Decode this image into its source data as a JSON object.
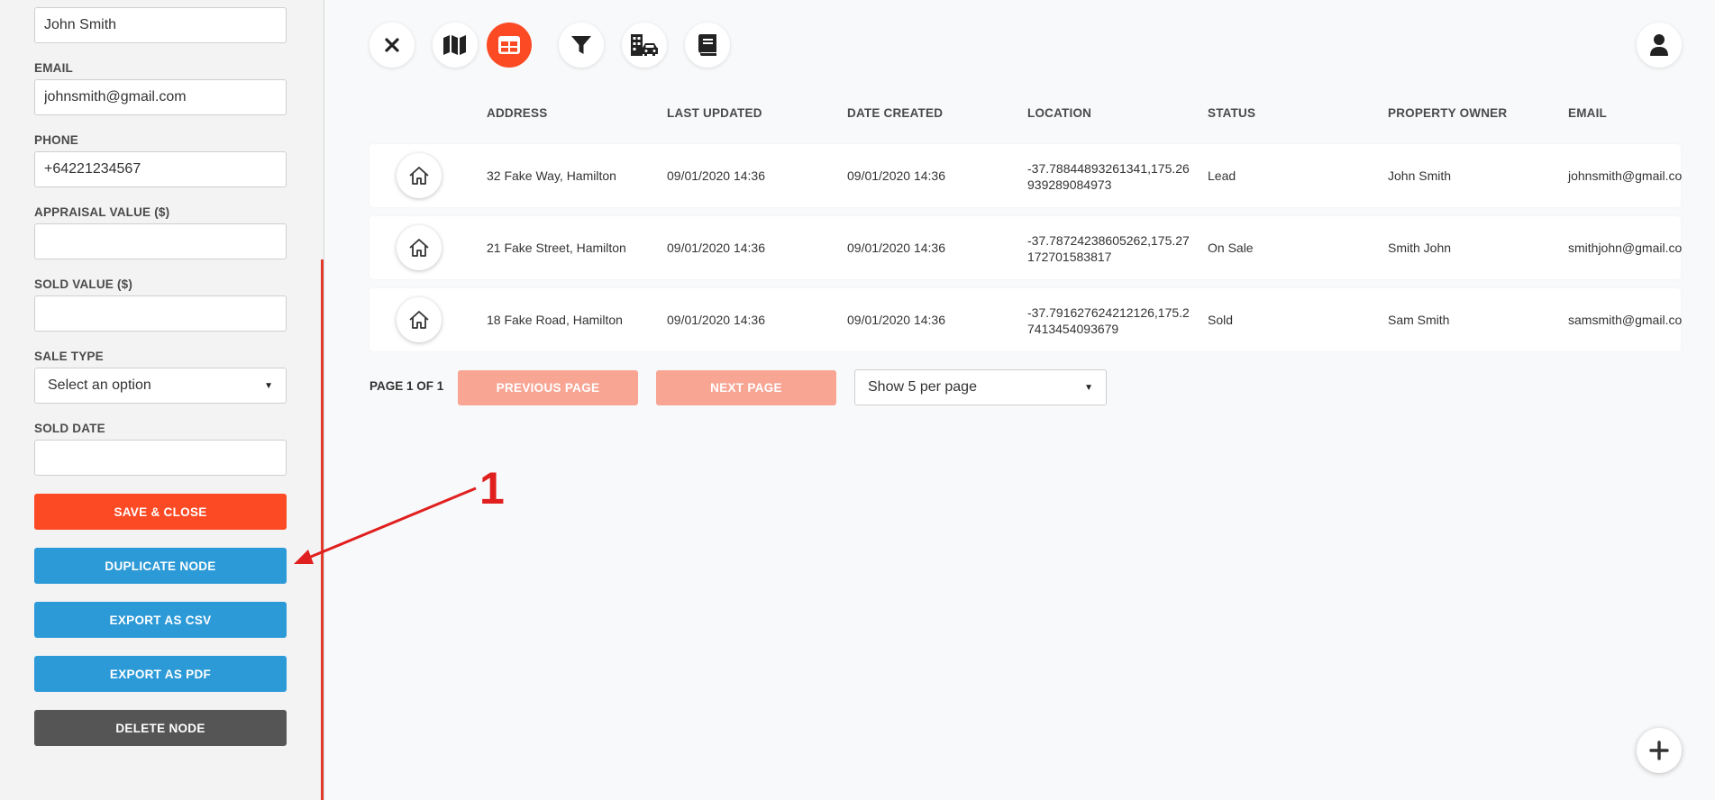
{
  "form": {
    "name_value": "John Smith",
    "email_label": "EMAIL",
    "email_value": "johnsmith@gmail.com",
    "phone_label": "PHONE",
    "phone_value": "+64221234567",
    "appraisal_label": "APPRAISAL VALUE ($)",
    "appraisal_value": "",
    "sold_value_label": "SOLD VALUE ($)",
    "sold_value_value": "",
    "sale_type_label": "SALE TYPE",
    "sale_type_value": "Select an option",
    "sold_date_label": "SOLD DATE",
    "sold_date_value": ""
  },
  "actions": {
    "save_close": "SAVE & CLOSE",
    "duplicate": "DUPLICATE NODE",
    "export_csv": "EXPORT AS CSV",
    "export_pdf": "EXPORT AS PDF",
    "delete": "DELETE NODE"
  },
  "annotation": {
    "number": "1",
    "color": "#e01f1f"
  },
  "toolbar": {
    "items": [
      {
        "icon": "close-icon"
      },
      {
        "icon": "map-icon"
      },
      {
        "icon": "table-icon",
        "active": true
      },
      {
        "icon": "filter-icon"
      },
      {
        "icon": "building-car-icon"
      },
      {
        "icon": "book-icon"
      }
    ],
    "accent_color": "#fc4a24"
  },
  "table": {
    "headers": [
      "ADDRESS",
      "LAST UPDATED",
      "DATE CREATED",
      "LOCATION",
      "STATUS",
      "PROPERTY OWNER",
      "EMAIL"
    ],
    "rows": [
      {
        "address": "32 Fake Way, Hamilton",
        "last_updated": "09/01/2020 14:36",
        "date_created": "09/01/2020 14:36",
        "location": "-37.78844893261341,175.26939289084973",
        "status": "Lead",
        "owner": "John Smith",
        "email": "johnsmith@gmail.co"
      },
      {
        "address": "21 Fake Street, Hamilton",
        "last_updated": "09/01/2020 14:36",
        "date_created": "09/01/2020 14:36",
        "location": "-37.78724238605262,175.27172701583817",
        "status": "On Sale",
        "owner": "Smith John",
        "email": "smithjohn@gmail.co"
      },
      {
        "address": "18 Fake Road, Hamilton",
        "last_updated": "09/01/2020 14:36",
        "date_created": "09/01/2020 14:36",
        "location": "-37.791627624212126,175.27413454093679",
        "status": "Sold",
        "owner": "Sam Smith",
        "email": "samsmith@gmail.co"
      }
    ]
  },
  "pagination": {
    "page_label": "PAGE 1 OF 1",
    "previous": "PREVIOUS PAGE",
    "next": "NEXT PAGE",
    "per_page": "Show 5 per page"
  },
  "colors": {
    "save": "#fc4a24",
    "blue": "#2d9ad8",
    "delete": "#555555",
    "disabled_pager": "#f8a594"
  }
}
